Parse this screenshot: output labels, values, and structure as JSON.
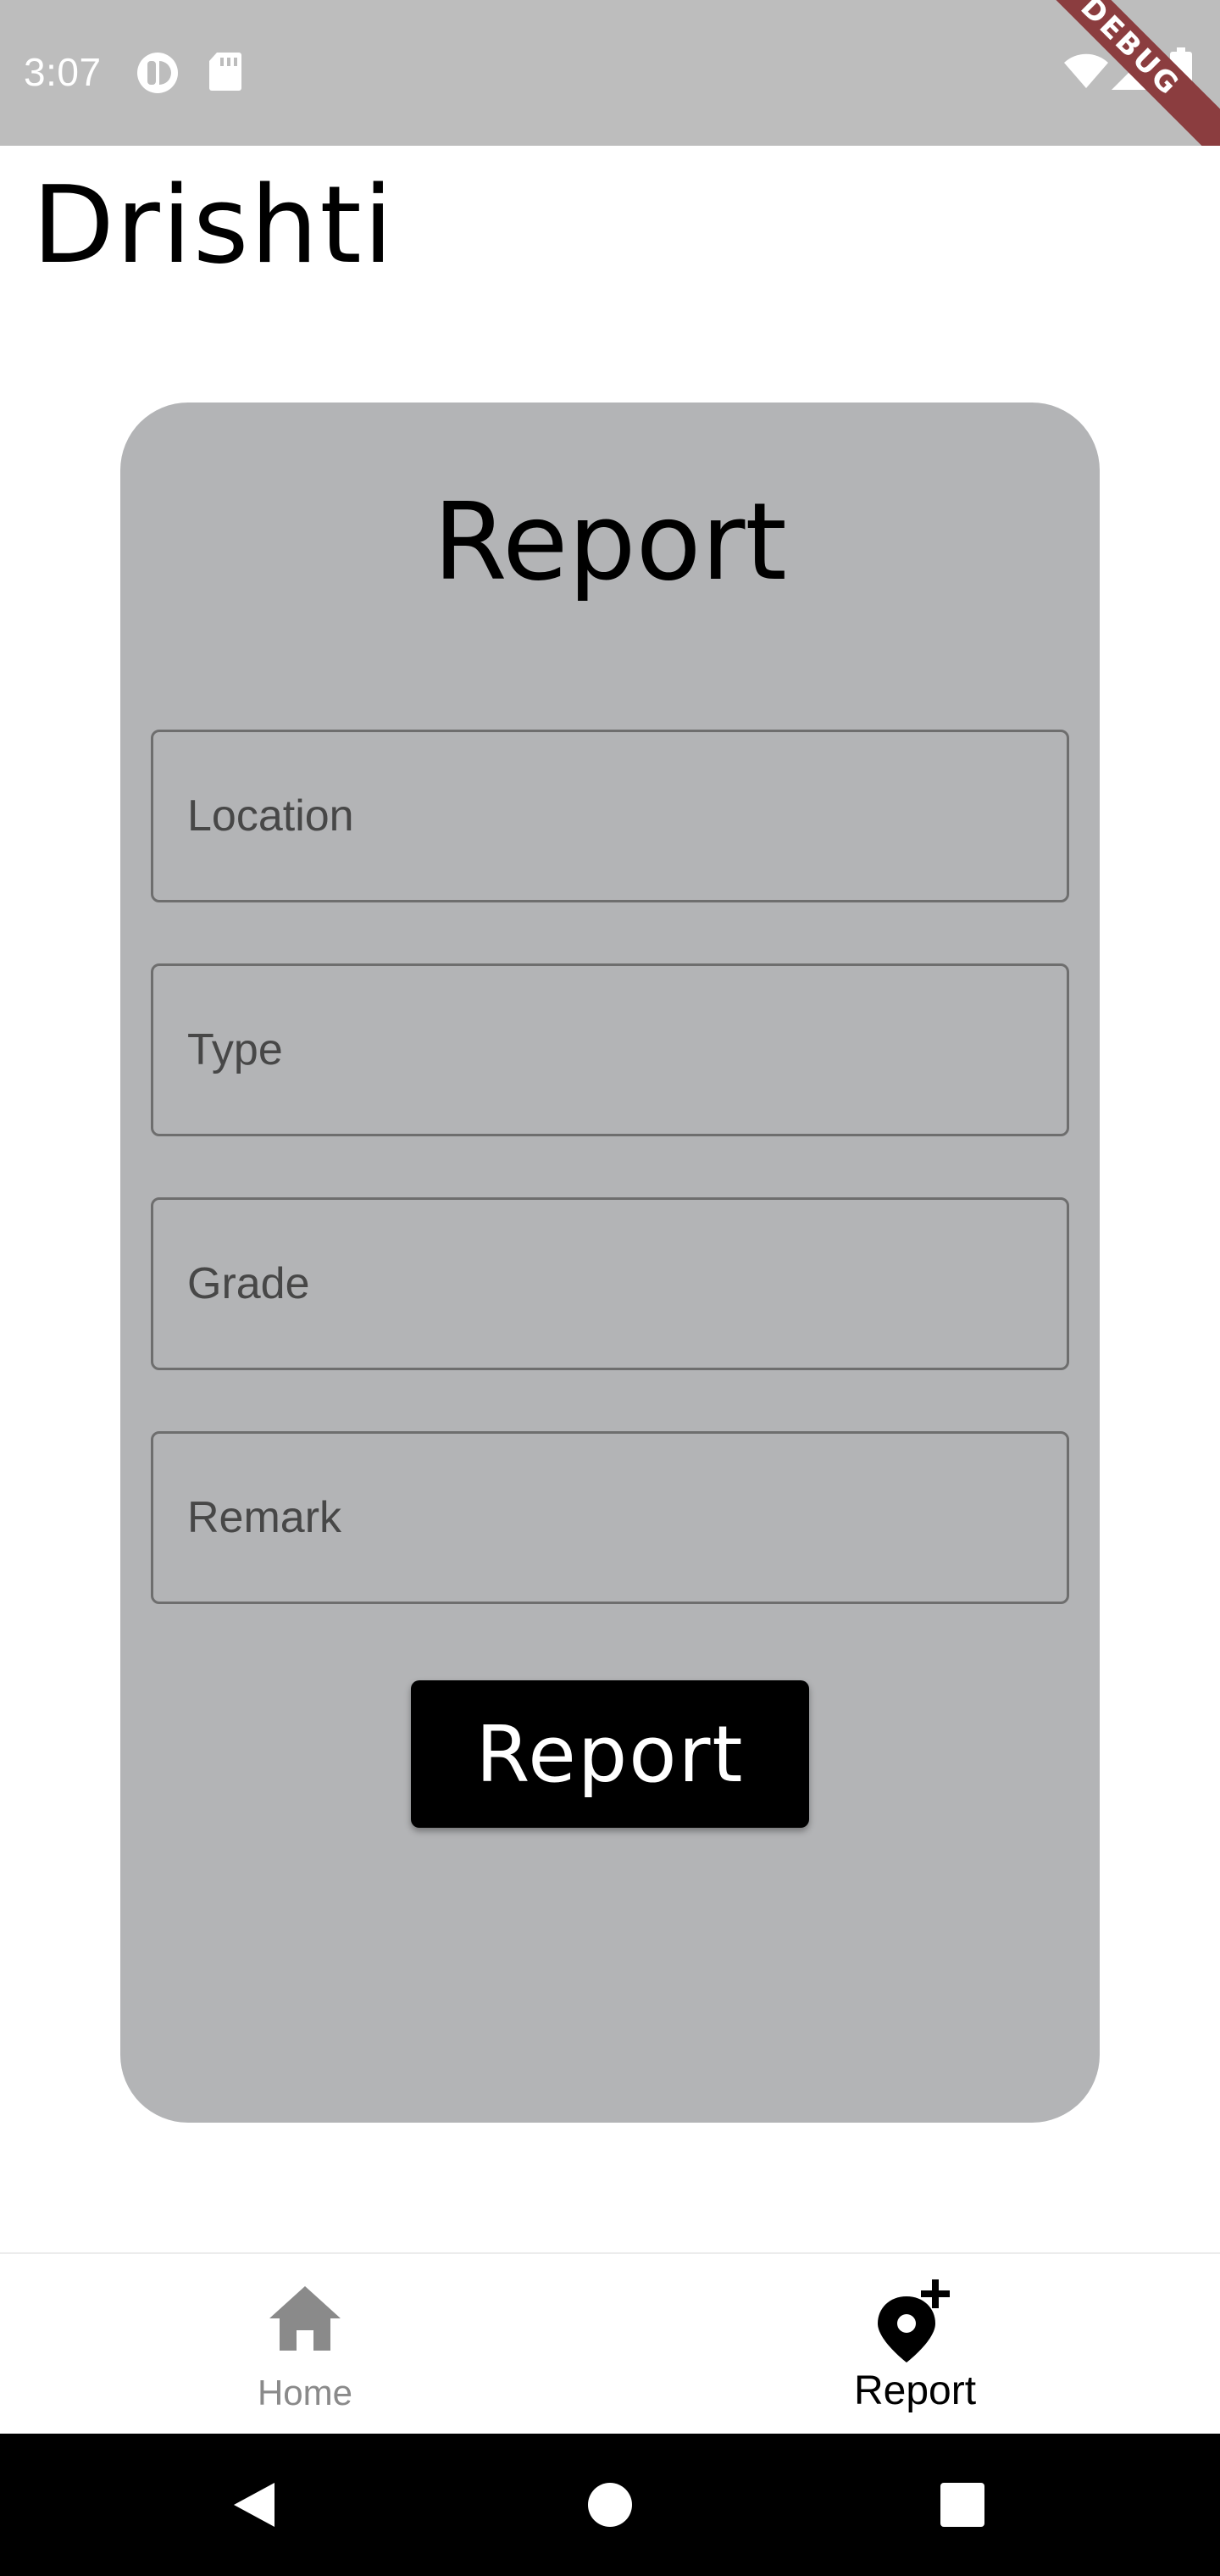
{
  "status_bar": {
    "time": "3:07",
    "debug_label": "DEBUG",
    "icons": [
      "notification-icon",
      "sd-card-icon",
      "wifi-icon",
      "signal-icon",
      "battery-icon"
    ]
  },
  "app": {
    "title": "Drishti"
  },
  "form": {
    "title": "Report",
    "fields": [
      {
        "placeholder": "Location"
      },
      {
        "placeholder": "Type"
      },
      {
        "placeholder": "Grade"
      },
      {
        "placeholder": "Remark"
      }
    ],
    "submit_label": "Report"
  },
  "bottom_nav": {
    "items": [
      {
        "label": "Home",
        "icon": "home-icon",
        "active": false
      },
      {
        "label": "Report",
        "icon": "add-location-icon",
        "active": true
      }
    ]
  },
  "system_nav": {
    "buttons": [
      "back-icon",
      "home-circle-icon",
      "recents-icon"
    ]
  },
  "colors": {
    "status_bar": "#bdbdbd",
    "card": "#b3b4b6",
    "button": "#000000",
    "nav_inactive": "#8a8a8a",
    "nav_active": "#000000",
    "debug_banner": "#8b3d3f"
  }
}
